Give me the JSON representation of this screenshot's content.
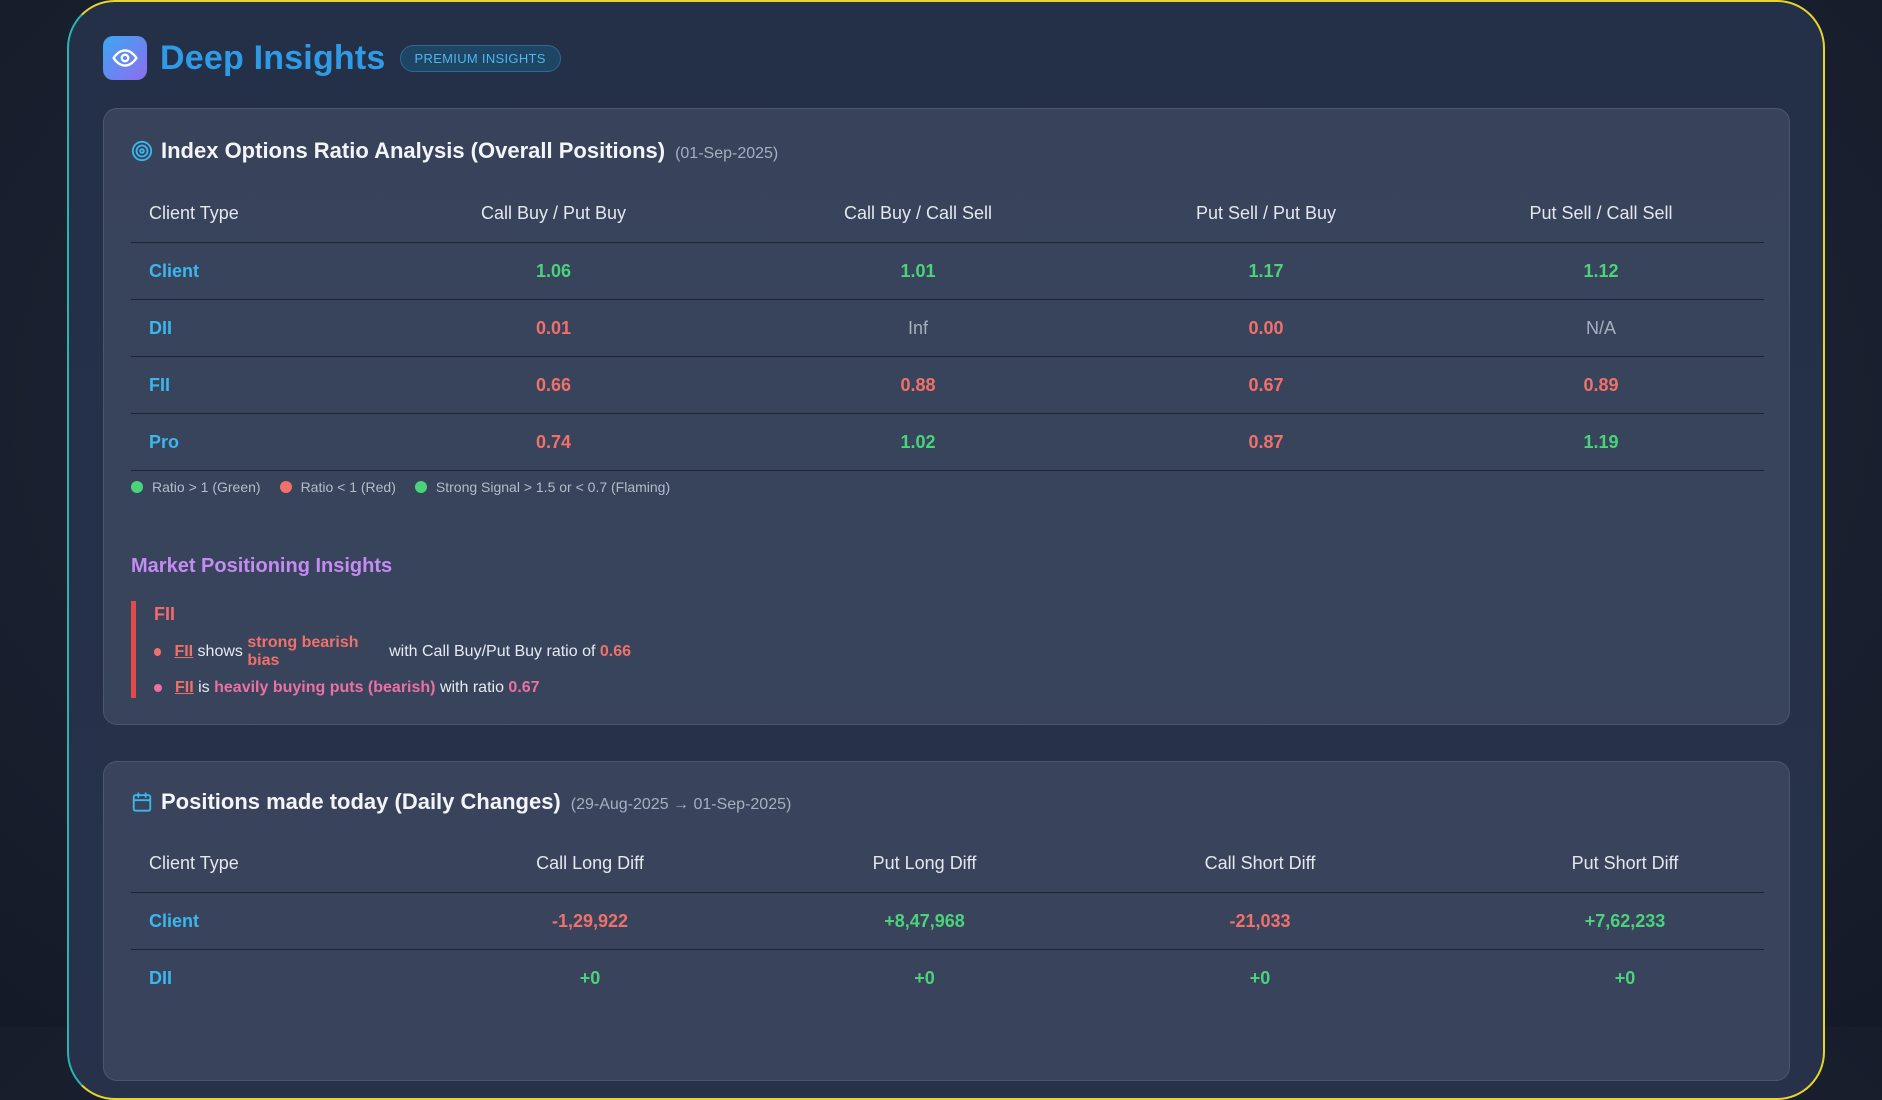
{
  "header": {
    "title": "Deep Insights",
    "badge": "PREMIUM INSIGHTS"
  },
  "ratio_panel": {
    "title": "Index Options Ratio Analysis (Overall Positions)",
    "date": "(01-Sep-2025)",
    "columns": [
      "Client Type",
      "Call Buy / Put Buy",
      "Call Buy / Call Sell",
      "Put Sell / Put Buy",
      "Put Sell / Call Sell"
    ],
    "rows": [
      {
        "type": "Client",
        "v1": "1.06",
        "v2": "1.01",
        "v3": "1.17",
        "v4": "1.12"
      },
      {
        "type": "DII",
        "v1": "0.01",
        "v2": "Inf",
        "v3": "0.00",
        "v4": "N/A"
      },
      {
        "type": "FII",
        "v1": "0.66",
        "v2": "0.88",
        "v3": "0.67",
        "v4": "0.89"
      },
      {
        "type": "Pro",
        "v1": "0.74",
        "v2": "1.02",
        "v3": "0.87",
        "v4": "1.19"
      }
    ],
    "legend": [
      "Ratio > 1 (Green)",
      "Ratio < 1 (Red)",
      "Strong Signal > 1.5 or < 0.7 (Flaming)"
    ],
    "colors": {
      "positive": "#4ad37a",
      "negative": "#f0706a",
      "neutral": "#a8afbd"
    }
  },
  "insights": {
    "title": "Market Positioning Insights",
    "entity": "FII",
    "line1": {
      "who": "FII",
      "pre": " shows ",
      "emph": "strong bearish bias",
      "mid": " with Call Buy/Put Buy ratio of ",
      "value": "0.66"
    },
    "line2": {
      "who": "FII",
      "pre": " is ",
      "emph": "heavily buying puts (bearish)",
      "mid": " with ratio ",
      "value": "0.67"
    }
  },
  "daily_panel": {
    "title": "Positions made today (Daily Changes)",
    "date": "(29-Aug-2025 → 01-Sep-2025)",
    "columns": [
      "Client Type",
      "Call Long Diff",
      "Put Long Diff",
      "Call Short Diff",
      "Put Short Diff"
    ],
    "rows": [
      {
        "type": "Client",
        "v1": "-1,29,922",
        "v2": "+8,47,968",
        "v3": "-21,033",
        "v4": "+7,62,233"
      },
      {
        "type": "DII",
        "v1": "+0",
        "v2": "+0",
        "v3": "+0",
        "v4": "+0"
      }
    ]
  }
}
